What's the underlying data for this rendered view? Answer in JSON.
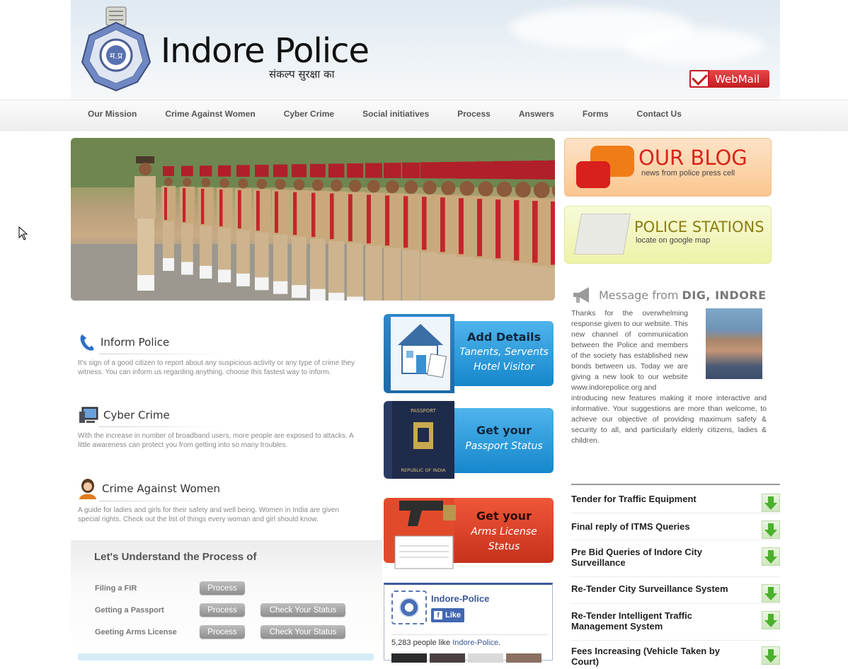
{
  "header": {
    "brand": "Indore Police",
    "tagline": "संकल्प सुरक्षा का",
    "webmail_label": "WebMail"
  },
  "nav": {
    "items": [
      "Our Mission",
      "Crime Against Women",
      "Cyber Crime",
      "Social initiatives",
      "Process",
      "Answers",
      "Forms",
      "Contact Us"
    ]
  },
  "banners": {
    "blog_title": "OUR BLOG",
    "blog_subtitle": "news from police press cell",
    "stations_title": "POLICE STATIONS",
    "stations_subtitle": "locate on google map"
  },
  "dig_message": {
    "title_prefix": "Message from",
    "title_bold": "DIG, INDORE",
    "text_narrow": "Thanks for the overwhelming response given to our website. This new channel of communication between the Police and members of the society has established new bonds between us. Today we are giving a new look to our website www.indorepolice.org and",
    "text_wide": "introducing new features making it more interactive and informative. Your suggestions are more than welcome, to achieve our objective of providing maximum safety & security to all, and particularly elderly citizens, ladies & children."
  },
  "tenders": [
    "Tender for Traffic Equipment",
    "Final reply of ITMS Queries",
    "Pre Bid Queries of Indore City Surveillance",
    "Re-Tender City Surveillance System",
    "Re-Tender Intelligent Traffic Management System",
    "Fees Increasing (Vehicle Taken by Court)"
  ],
  "info": [
    {
      "title": "Inform Police",
      "desc": "It's sign of a good citizen to report about any suspicious activity or any type of crime they witness. You can inform us regarding anything. choose this fastest way to inform."
    },
    {
      "title": "Cyber Crime",
      "desc": "With the increase in number of broadband users, more people are exposed to attacks. A little awareness can protect you from getting into so many troubles."
    },
    {
      "title": "Crime Against Women",
      "desc": "A guide for ladies and girls for their safety and well being. Women in India are given special rights. Check out the list of things every woman and girl should know."
    }
  ],
  "process": {
    "heading": "Let's Understand the Process of",
    "rows": [
      {
        "label": "Filing a FIR",
        "process": "Process"
      },
      {
        "label": "Getting a Passport",
        "process": "Process",
        "check": "Check Your Status"
      },
      {
        "label": "Geeting Arms License",
        "process": "Process",
        "check": "Check Your Status"
      }
    ]
  },
  "services": [
    {
      "line1": "Add Details",
      "line2a": "Tanents, Servents",
      "line2b": "Hotel Visitor"
    },
    {
      "line1": "Get your",
      "line2a": "Passport Status",
      "line2b": ""
    },
    {
      "line1": "Get your",
      "line2a": "Arms License",
      "line2b": "Status"
    }
  ],
  "facebook": {
    "page_name": "Indore-Police",
    "like_label": "Like",
    "count_text": "5,283 people like",
    "count_link": "Indore-Police",
    "count_end": "."
  },
  "colors": {
    "nav_text": "#555555",
    "blog_red": "#d7261b",
    "stations_olive": "#8a7e12",
    "facebook_blue": "#3b5998",
    "download_green": "#4bb02e"
  }
}
